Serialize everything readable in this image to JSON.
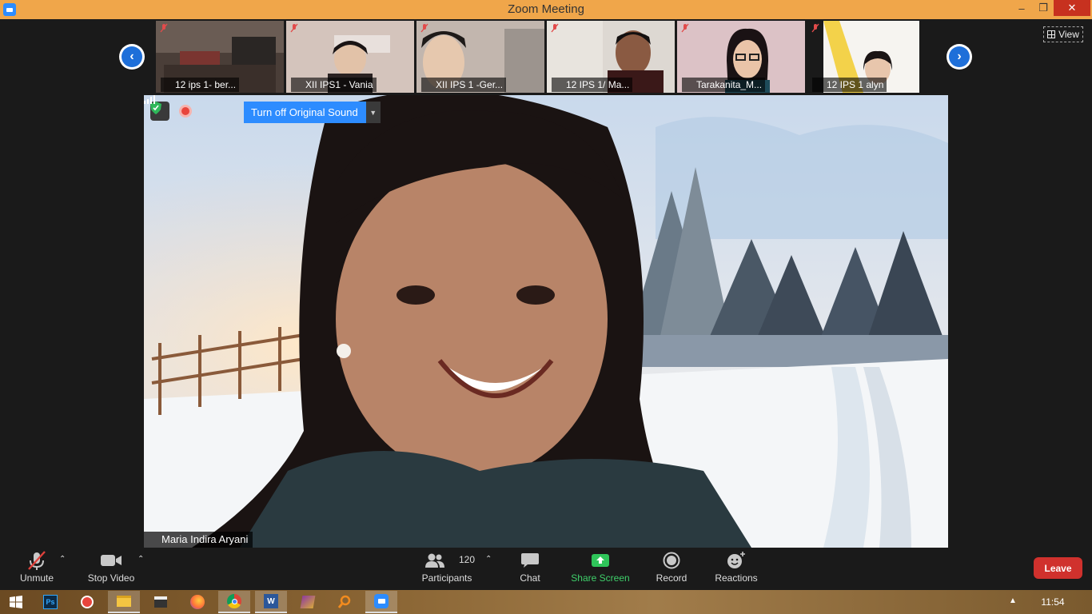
{
  "window": {
    "title": "Zoom Meeting",
    "minimize": "–",
    "maximize": "❐",
    "close": "✕"
  },
  "strip": {
    "participants": [
      {
        "name": "12 ips 1- ber...",
        "bg": "#5a4c44"
      },
      {
        "name": "XII IPS1 - Vania",
        "bg": "#c9b8b0"
      },
      {
        "name": "XII IPS 1 -Ger...",
        "bg": "#b8aca4"
      },
      {
        "name": "12 IPS 1/ Ma...",
        "bg": "#8a8078"
      },
      {
        "name": "Tarakanita_M...",
        "bg": "#d8bfc2"
      },
      {
        "name": "12 IPS 1 alyn",
        "bg": "#f4f2ee"
      }
    ],
    "view_label": "View"
  },
  "main": {
    "speaker": "Maria Indira Aryani",
    "original_sound_label": "Turn off Original Sound"
  },
  "toolbar": {
    "unmute": "Unmute",
    "stop_video": "Stop Video",
    "participants": "Participants",
    "participants_count": "120",
    "chat": "Chat",
    "share_screen": "Share Screen",
    "record": "Record",
    "reactions": "Reactions",
    "leave": "Leave"
  },
  "taskbar": {
    "apps": [
      "windows-start-icon",
      "photoshop-icon",
      "media-player-icon",
      "file-explorer-icon",
      "clapperboard-icon",
      "firefox-icon",
      "chrome-icon",
      "word-icon",
      "winrar-icon",
      "search-tool-icon",
      "zoom-icon"
    ],
    "clock": "11:54",
    "tray_caret": "▲"
  },
  "colors": {
    "zoom_blue": "#2d8cff",
    "leave_red": "#d0312d",
    "share_green": "#3fcf6a",
    "titlebar": "#f0a64a"
  }
}
